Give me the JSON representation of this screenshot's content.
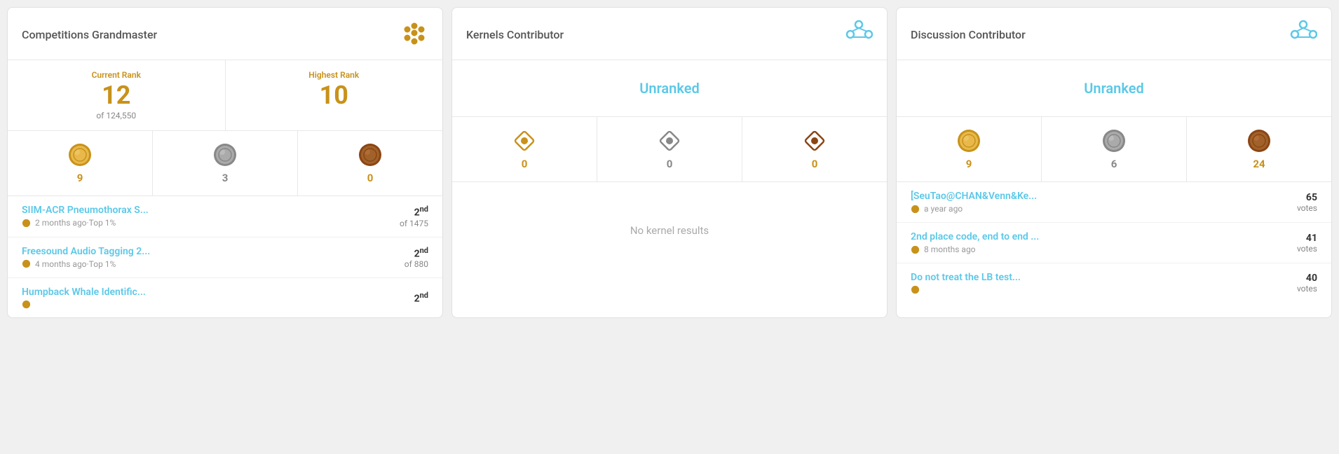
{
  "panels": [
    {
      "id": "competitions",
      "title": "Competitions Grandmaster",
      "icon_type": "grandmaster",
      "has_rank": true,
      "current_rank_label": "Current Rank",
      "current_rank": "12",
      "highest_rank_label": "Highest Rank",
      "highest_rank": "10",
      "rank_total": "of 124,550",
      "medals": [
        {
          "count": "9",
          "color": "gold",
          "type": "gold"
        },
        {
          "count": "3",
          "color": "silver",
          "type": "silver"
        },
        {
          "count": "0",
          "color": "bronze",
          "type": "bronze"
        }
      ],
      "entries": [
        {
          "title": "SIIM-ACR Pneumothorax S...",
          "meta_icon": "gold",
          "meta": "2 months ago·Top 1%",
          "place": "2",
          "place_suffix": "nd",
          "place_label": "of 1475",
          "votes": null
        },
        {
          "title": "Freesound Audio Tagging 2...",
          "meta_icon": "gold",
          "meta": "4 months ago·Top 1%",
          "place": "2",
          "place_suffix": "nd",
          "place_label": "of 880",
          "votes": null
        },
        {
          "title": "Humpback Whale Identific...",
          "meta_icon": "gold",
          "meta": "",
          "place": "2",
          "place_suffix": "nd",
          "place_label": "",
          "votes": null
        }
      ],
      "no_results": null
    },
    {
      "id": "kernels",
      "title": "Kernels Contributor",
      "icon_type": "contributor",
      "has_rank": false,
      "unranked_text": "Unranked",
      "medals": [
        {
          "count": "0",
          "color": "gold",
          "type": "gold"
        },
        {
          "count": "0",
          "color": "silver",
          "type": "silver"
        },
        {
          "count": "0",
          "color": "bronze",
          "type": "bronze"
        }
      ],
      "entries": [],
      "no_results": "No kernel results"
    },
    {
      "id": "discussion",
      "title": "Discussion Contributor",
      "icon_type": "contributor",
      "has_rank": false,
      "unranked_text": "Unranked",
      "medals": [
        {
          "count": "9",
          "color": "gold",
          "type": "gold"
        },
        {
          "count": "6",
          "color": "silver",
          "type": "silver"
        },
        {
          "count": "24",
          "color": "bronze",
          "type": "bronze"
        }
      ],
      "entries": [
        {
          "title": "[SeuTao@CHAN&Venn&Ke...",
          "meta_icon": "gold",
          "meta": "a year ago",
          "place": null,
          "votes": "65",
          "votes_label": "votes"
        },
        {
          "title": "2nd place code, end to end ...",
          "meta_icon": "gold",
          "meta": "8 months ago",
          "place": null,
          "votes": "41",
          "votes_label": "votes"
        },
        {
          "title": "Do not treat the LB test...",
          "meta_icon": "gold",
          "meta": "",
          "place": null,
          "votes": "40",
          "votes_label": ""
        }
      ],
      "no_results": null
    }
  ]
}
